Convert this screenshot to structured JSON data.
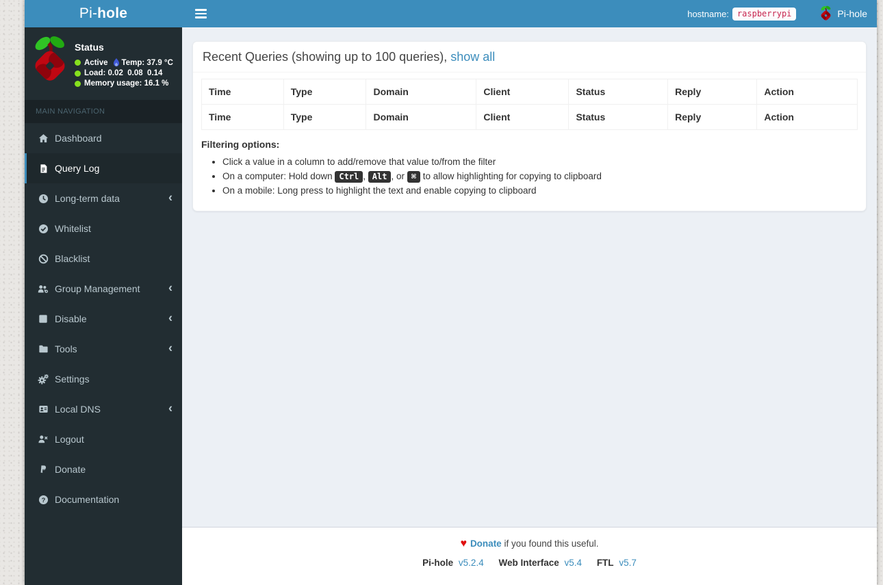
{
  "brand": {
    "prefix": "Pi-",
    "bold": "hole"
  },
  "topbar": {
    "hostname_label": "hostname:",
    "hostname_value": "raspberrypi",
    "logo_label": "Pi-hole"
  },
  "sidebar": {
    "status": {
      "title": "Status",
      "active_label": "Active",
      "temp_label": "Temp:",
      "temp_value": "37.9 °C",
      "load_label": "Load:",
      "load_values": "0.02  0.08  0.14",
      "memory_label": "Memory usage:",
      "memory_value": "16.1 %"
    },
    "section_header": "MAIN NAVIGATION",
    "items": [
      {
        "label": "Dashboard",
        "icon": "home-icon",
        "active": false,
        "expandable": false
      },
      {
        "label": "Query Log",
        "icon": "file-icon",
        "active": true,
        "expandable": false
      },
      {
        "label": "Long-term data",
        "icon": "clock-icon",
        "active": false,
        "expandable": true
      },
      {
        "label": "Whitelist",
        "icon": "check-circle-icon",
        "active": false,
        "expandable": false
      },
      {
        "label": "Blacklist",
        "icon": "ban-icon",
        "active": false,
        "expandable": false
      },
      {
        "label": "Group Management",
        "icon": "users-gear-icon",
        "active": false,
        "expandable": true
      },
      {
        "label": "Disable",
        "icon": "stop-icon",
        "active": false,
        "expandable": true
      },
      {
        "label": "Tools",
        "icon": "folder-icon",
        "active": false,
        "expandable": true
      },
      {
        "label": "Settings",
        "icon": "gears-icon",
        "active": false,
        "expandable": false
      },
      {
        "label": "Local DNS",
        "icon": "address-card-icon",
        "active": false,
        "expandable": true
      },
      {
        "label": "Logout",
        "icon": "user-times-icon",
        "active": false,
        "expandable": false
      },
      {
        "label": "Donate",
        "icon": "paypal-icon",
        "active": false,
        "expandable": false
      },
      {
        "label": "Documentation",
        "icon": "question-circle-icon",
        "active": false,
        "expandable": false
      }
    ]
  },
  "main": {
    "panel": {
      "title": "Recent Queries (showing up to 100 queries),",
      "show_all_label": "show all",
      "table": {
        "headers": [
          "Time",
          "Type",
          "Domain",
          "Client",
          "Status",
          "Reply",
          "Action"
        ]
      },
      "filtering": {
        "title": "Filtering options:",
        "bullet1": "Click a value in a column to add/remove that value to/from the filter",
        "bullet2_pre": "On a computer: Hold down ",
        "kbd_ctrl": "Ctrl",
        "sep1": ", ",
        "kbd_alt": "Alt",
        "sep2": ", or ",
        "kbd_cmd": "⌘",
        "bullet2_post": " to allow highlighting for copying to clipboard",
        "bullet3": "On a mobile: Long press to highlight the text and enable copying to clipboard"
      }
    }
  },
  "footer": {
    "donate_label": "Donate",
    "donate_suffix": " if you found this useful.",
    "versions": [
      {
        "name": "Pi-hole",
        "version": "v5.2.4"
      },
      {
        "name": "Web Interface",
        "version": "v5.4"
      },
      {
        "name": "FTL",
        "version": "v5.7"
      }
    ]
  },
  "colors": {
    "navbar_blue": "#3c8dbc",
    "sidebar_dark": "#222d32",
    "sidebar_active_bg": "#1e282c",
    "content_bg": "#ecf0f5",
    "link_blue": "#3c8dbc",
    "status_green": "#86e01e",
    "temp_flame_blue": "#3f58d6",
    "hostname_code_red": "#c7254e",
    "heart_red": "#e01010"
  }
}
